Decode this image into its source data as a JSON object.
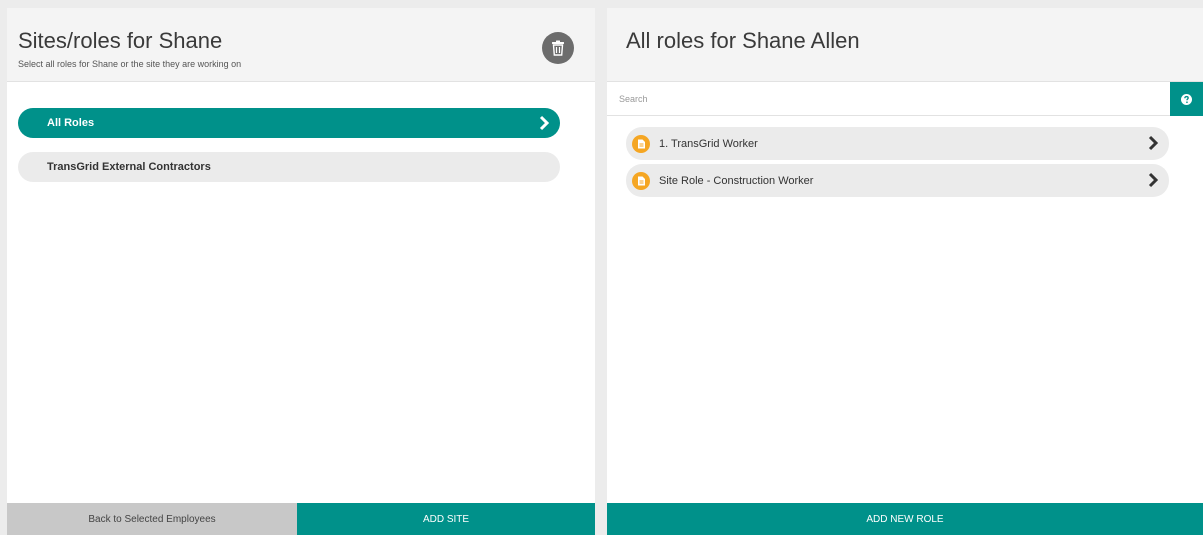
{
  "left_panel": {
    "title": "Sites/roles for Shane",
    "subtitle": "Select all roles for Shane or the site they are working on",
    "items": [
      {
        "label": "All Roles",
        "active": true
      },
      {
        "label": "TransGrid External Contractors",
        "active": false
      }
    ],
    "back_label": "Back to Selected Employees",
    "add_site_label": "ADD SITE",
    "icons": {
      "delete": "trash-icon",
      "chevron": "chevron-right-icon"
    }
  },
  "right_panel": {
    "title": "All roles for Shane Allen",
    "search": {
      "placeholder": "Search",
      "value": ""
    },
    "roles": [
      {
        "label": "1. TransGrid Worker"
      },
      {
        "label": "Site Role - Construction Worker"
      }
    ],
    "add_role_label": "ADD NEW ROLE",
    "icons": {
      "help": "question-icon",
      "role": "document-icon",
      "chevron": "chevron-right-icon"
    }
  },
  "colors": {
    "accent": "#00918a",
    "role_icon": "#f5a623",
    "delete_button": "#6c6c6c"
  }
}
